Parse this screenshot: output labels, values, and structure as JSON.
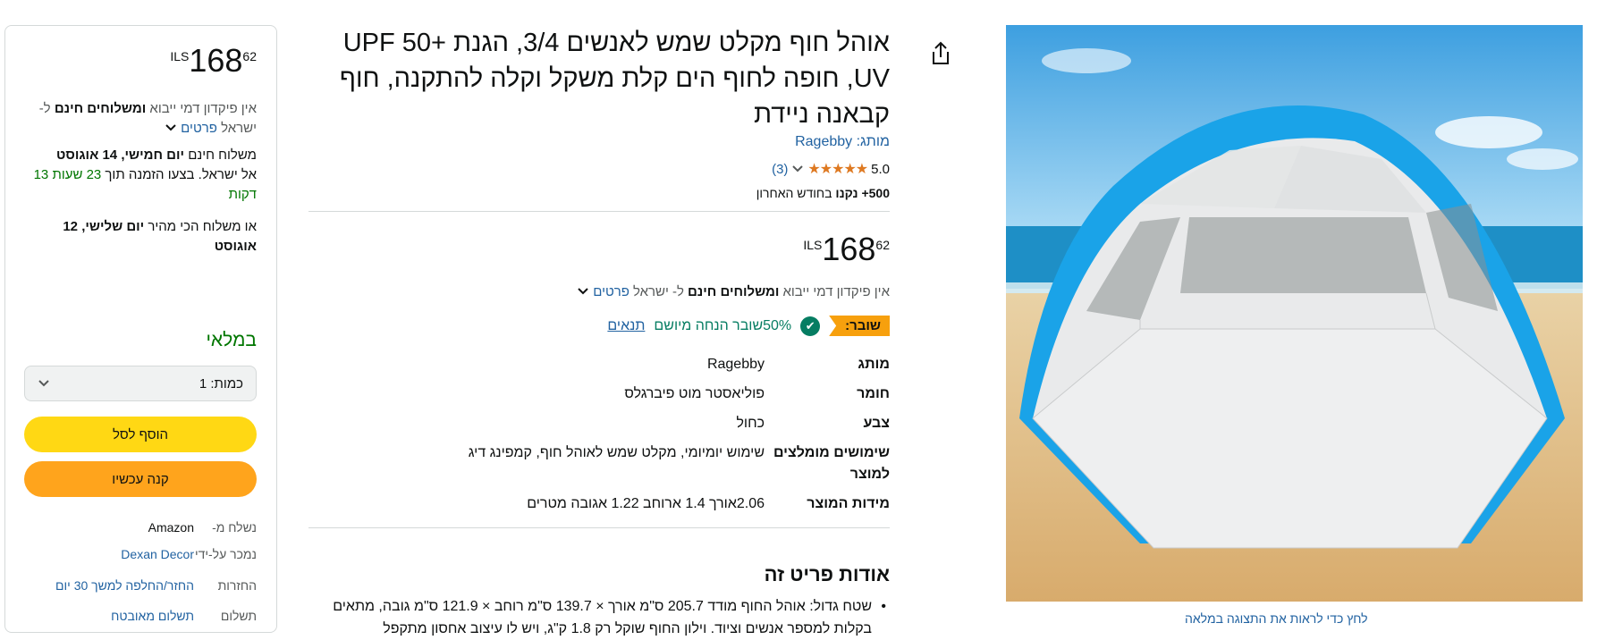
{
  "buybox": {
    "currency": "ILS",
    "price_whole": "168",
    "price_fraction": "62",
    "deposit_prefix": "אין פיקדון דמי ייבוא ",
    "deposit_bold": "ומשלוחים חינם",
    "deposit_suffix": "ל- ישראל ",
    "details_link": "פרטים",
    "delivery_prefix": "משלוח חינם ",
    "delivery_date": "יום חמישי, 14 אוגוסט",
    "delivery_line2_prefix": "אל ישראל. בצעו הזמנה תוך ",
    "countdown": "23 שעות 13 דקות",
    "fast_prefix": "או משלוח הכי מהיר ",
    "fast_date": "יום שלישי, 12 אוגוסט",
    "stock": "במלאי",
    "qty_label": "כמות: 1",
    "add_to_cart": "הוסף לסל",
    "buy_now": "קנה עכשיו",
    "meta": [
      {
        "k": "נשלח מ-",
        "v": "Amazon"
      },
      {
        "k": "נמכר על-ידי",
        "v": "Dexan Decor"
      },
      {
        "k": "החזרות",
        "v": "החזר/החלפה למשך 30 יום"
      },
      {
        "k": "תשלום",
        "v": "תשלום מאובטח"
      }
    ]
  },
  "product": {
    "title": "אוהל חוף מקלט שמש לאנשים 3/4, הגנת UPF 50+ UV, חופה לחוף הים קלת משקל וקלה להתקנה, חוף קבאנה ניידת",
    "brand_label": "מותג: Ragebby",
    "rating": "5.0",
    "stars": "★★★★★",
    "review_count": "(3)",
    "bought_bold": "500+ נקנו",
    "bought_suffix": " בחודש האחרון",
    "currency": "ILS",
    "price_whole": "168",
    "price_fraction": "62",
    "ship_prefix": "אין פיקדון דמי ייבוא ",
    "ship_bold": "ומשלוחים חינם",
    "ship_suffix": " ל- ישראל ",
    "details_link": "פרטים",
    "coupon_badge": "שובר:",
    "coupon_text": "50%שובר הנחה מיושם",
    "coupon_terms": "תנאים",
    "specs": [
      {
        "k": "מותג",
        "v": "Ragebby"
      },
      {
        "k": "חומר",
        "v": "פוליאסטר מוט פיברגלס"
      },
      {
        "k": "צבע",
        "v": "כחול"
      },
      {
        "k": "שימושים מומלצים למוצר",
        "v": "שימוש יומיומי, מקלט שמש לאוהל חוף, קמפינג דיג"
      },
      {
        "k": "מידות המוצר",
        "v": "2.06אורך 1.4 ארוחב 1.22 אגובה מטרים"
      }
    ],
    "about_heading": "אודות פריט זה",
    "bullet1": "שטח גדול: אוהל החוף מודד 205.7 ס\"מ אורך × 139.7 ס\"מ רוחב × 121.9 ס\"מ גובה, מתאים בקלות למספר אנשים וציוד. וילון החוף שוקל רק 1.8 ק\"ג, ויש לו עיצוב אחסון מתקפל"
  },
  "image": {
    "caption": "לחץ כדי לראות את התצוגה במלאה",
    "colors": {
      "sky": "#5fb6e8",
      "sea": "#1e8fc6",
      "sand": "#e6c48e",
      "tent_blue": "#1aa3e8",
      "tent_white": "#eceded"
    }
  }
}
